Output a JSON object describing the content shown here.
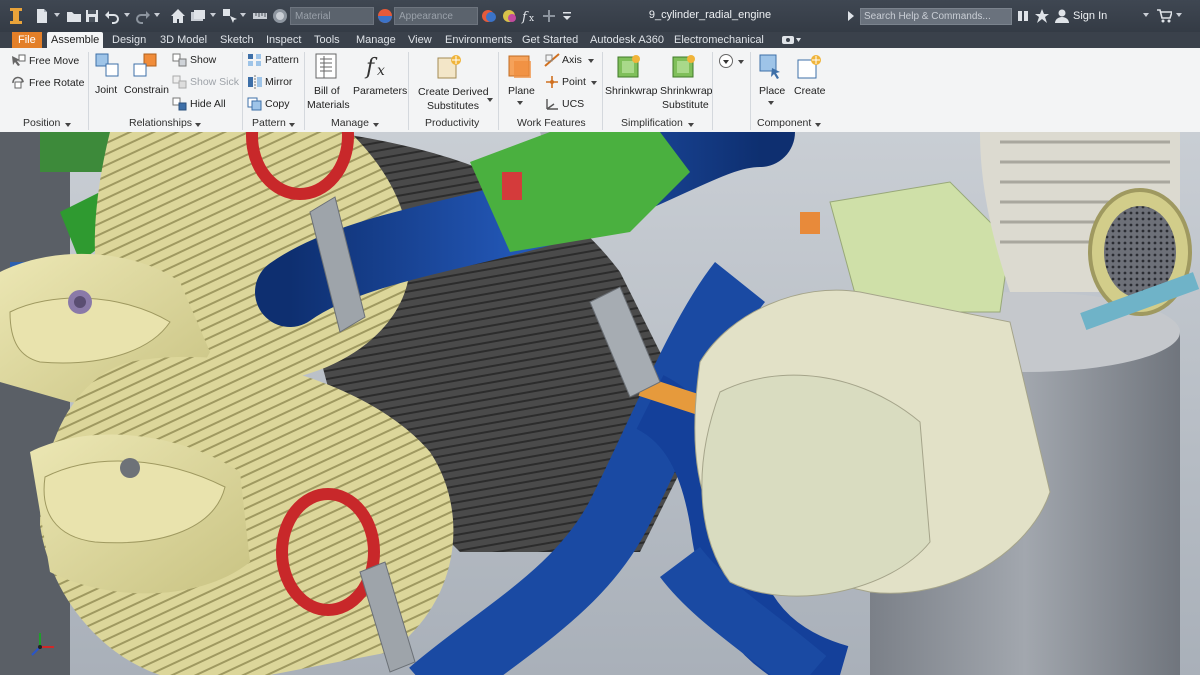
{
  "window": {
    "doc_title": "9_cylinder_radial_engine",
    "search_placeholder": "Search Help & Commands...",
    "sign_in": "Sign In",
    "material_select": "Material",
    "appearance_select": "Appearance"
  },
  "tabs": [
    "File",
    "Assemble",
    "Design",
    "3D Model",
    "Sketch",
    "Inspect",
    "Tools",
    "Manage",
    "View",
    "Environments",
    "Get Started",
    "Autodesk A360",
    "Electromechanical"
  ],
  "active_tab": "Assemble",
  "ribbon": {
    "position": {
      "title": "Position",
      "free_move": "Free Move",
      "free_rotate": "Free Rotate"
    },
    "relationships": {
      "title": "Relationships",
      "joint": "Joint",
      "constrain": "Constrain",
      "show": "Show",
      "show_sick": "Show Sick",
      "hide_all": "Hide All"
    },
    "pattern": {
      "title": "Pattern",
      "pattern": "Pattern",
      "mirror": "Mirror",
      "copy": "Copy"
    },
    "manage": {
      "title": "Manage",
      "bom_line1": "Bill of",
      "bom_line2": "Materials",
      "parameters": "Parameters"
    },
    "productivity": {
      "title": "Productivity",
      "line1": "Create Derived",
      "line2": "Substitutes"
    },
    "work_features": {
      "title": "Work Features",
      "plane": "Plane",
      "axis": "Axis",
      "point": "Point",
      "ucs": "UCS"
    },
    "simplification": {
      "title": "Simplification",
      "shrinkwrap": "Shrinkwrap",
      "shrinkwrap_sub_line1": "Shrinkwrap",
      "shrinkwrap_sub_line2": "Substitute"
    },
    "component": {
      "title": "Component",
      "place": "Place",
      "create": "Create"
    }
  },
  "colors": {
    "file_tab": "#e37f28",
    "engine_yellow": "#d9d49a",
    "hose_blue": "#123d8e",
    "ring_red": "#c8282a",
    "box_green": "#cfe0a8"
  }
}
